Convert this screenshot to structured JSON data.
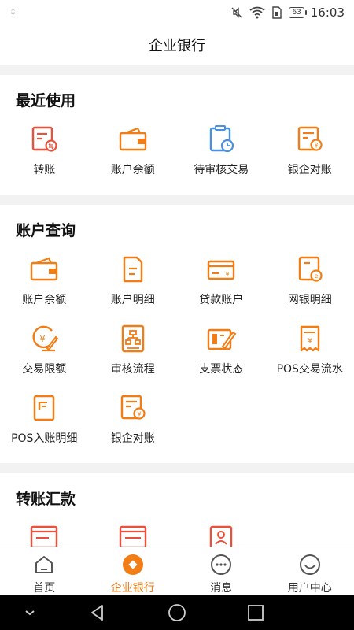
{
  "status_bar": {
    "time": "16:03",
    "battery": "63",
    "left_indicator": "⁑"
  },
  "header": {
    "title": "企业银行"
  },
  "sections": [
    {
      "title": "最近使用",
      "items": [
        {
          "label": "转账",
          "icon": "transfer-icon"
        },
        {
          "label": "账户余额",
          "icon": "wallet-icon"
        },
        {
          "label": "待审核交易",
          "icon": "pending-review-icon"
        },
        {
          "label": "银企对账",
          "icon": "reconcile-icon"
        }
      ]
    },
    {
      "title": "账户查询",
      "items": [
        {
          "label": "账户余额",
          "icon": "wallet-icon"
        },
        {
          "label": "账户明细",
          "icon": "document-icon"
        },
        {
          "label": "贷款账户",
          "icon": "loan-card-icon"
        },
        {
          "label": "网银明细",
          "icon": "ebank-detail-icon"
        },
        {
          "label": "交易限额",
          "icon": "limit-icon"
        },
        {
          "label": "审核流程",
          "icon": "flowchart-icon"
        },
        {
          "label": "支票状态",
          "icon": "cheque-icon"
        },
        {
          "label": "POS交易流水",
          "icon": "pos-receipt-icon"
        },
        {
          "label": "POS入账明细",
          "icon": "pos-entry-icon"
        },
        {
          "label": "银企对账",
          "icon": "reconcile-icon"
        }
      ]
    },
    {
      "title": "转账汇款",
      "items": []
    }
  ],
  "tabs": [
    {
      "label": "首页",
      "icon": "home-icon",
      "active": false
    },
    {
      "label": "企业银行",
      "icon": "enterprise-bank-icon",
      "active": true
    },
    {
      "label": "消息",
      "icon": "message-icon",
      "active": false
    },
    {
      "label": "用户中心",
      "icon": "user-center-icon",
      "active": false
    }
  ],
  "colors": {
    "accent": "#f07d16",
    "blue": "#4a90e2",
    "red": "#e8523c",
    "text": "#222222"
  }
}
